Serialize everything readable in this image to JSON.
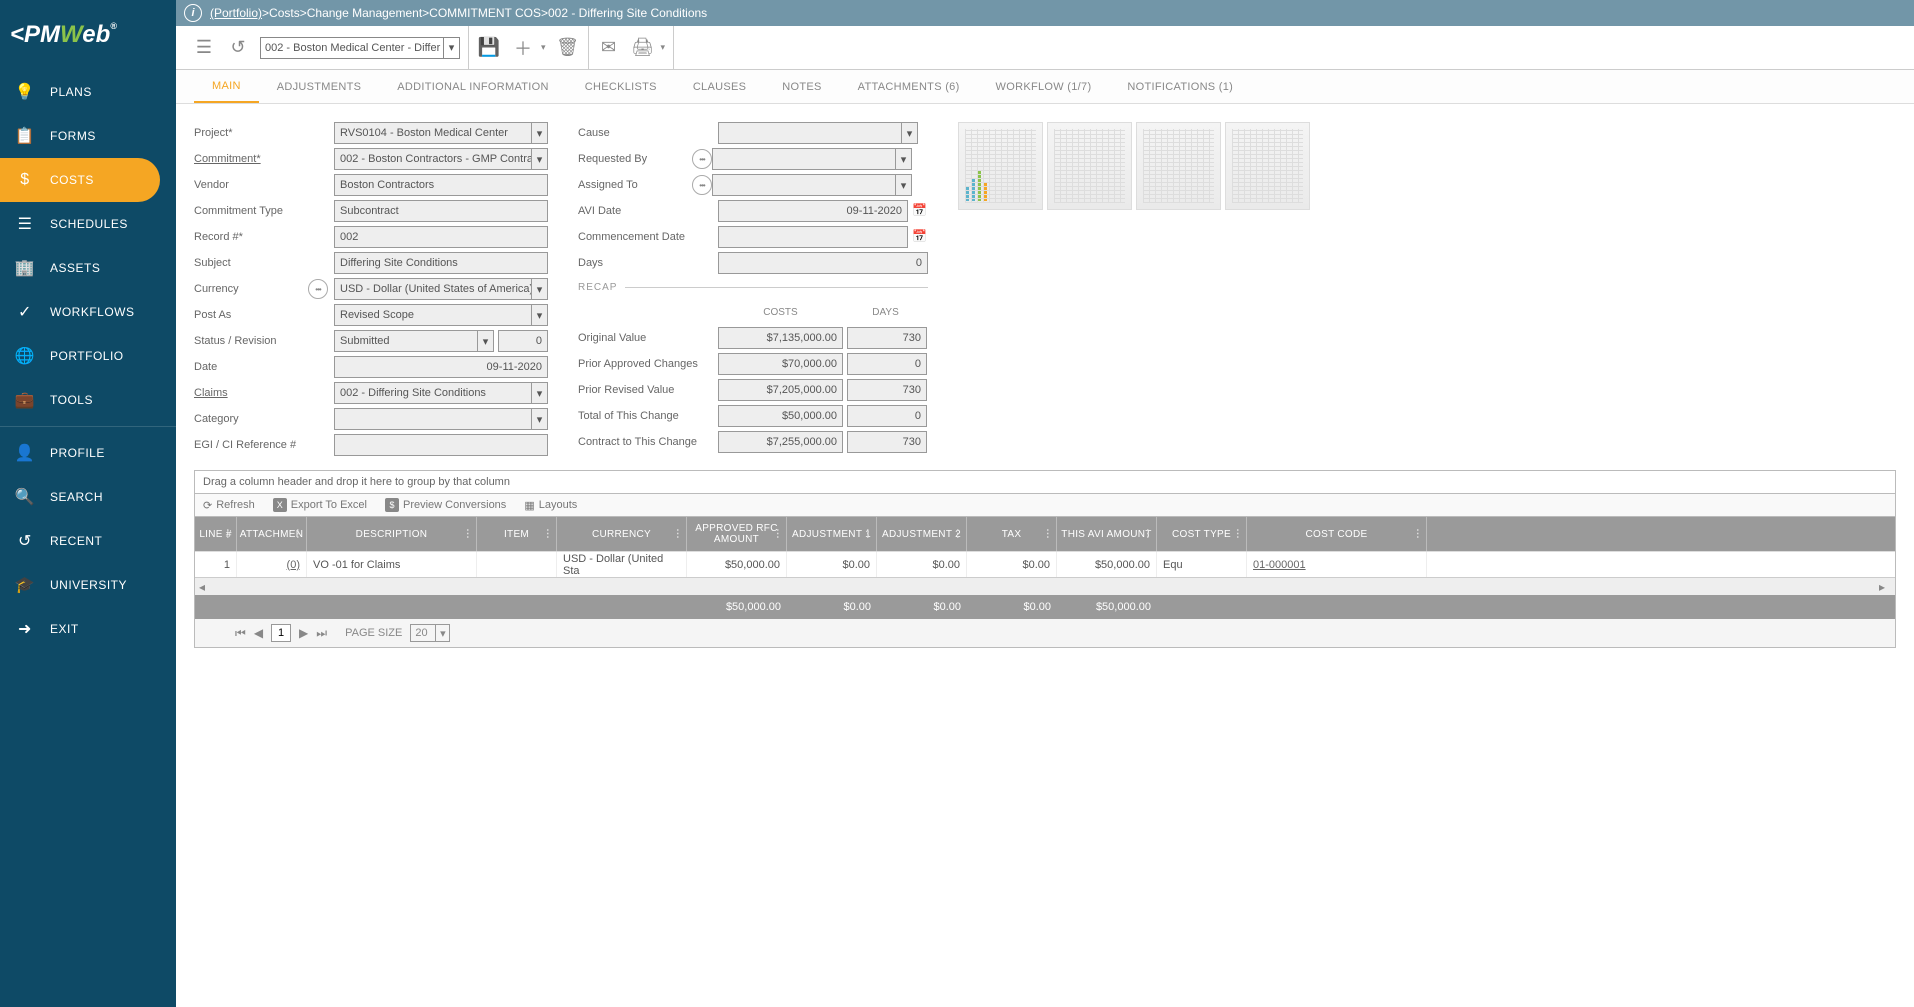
{
  "breadcrumb": {
    "root": "(Portfolio)",
    "sep": " > ",
    "items": [
      "Costs",
      "Change Management",
      "COMMITMENT COS",
      "002 - Differing Site Conditions"
    ]
  },
  "toolbar": {
    "record_selector": "002 - Boston Medical Center - Differ"
  },
  "sidebar": {
    "items": [
      "PLANS",
      "FORMS",
      "COSTS",
      "SCHEDULES",
      "ASSETS",
      "WORKFLOWS",
      "PORTFOLIO",
      "TOOLS"
    ],
    "footer": [
      "PROFILE",
      "SEARCH",
      "RECENT",
      "UNIVERSITY",
      "EXIT"
    ]
  },
  "tabs": [
    "MAIN",
    "ADJUSTMENTS",
    "ADDITIONAL INFORMATION",
    "CHECKLISTS",
    "CLAUSES",
    "NOTES",
    "ATTACHMENTS (6)",
    "WORKFLOW (1/7)",
    "NOTIFICATIONS (1)"
  ],
  "form": {
    "project_lbl": "Project*",
    "project": "RVS0104 - Boston Medical Center",
    "commitment_lbl": "Commitment*",
    "commitment": "002 - Boston Contractors - GMP Contra",
    "vendor_lbl": "Vendor",
    "vendor": "Boston Contractors",
    "ctype_lbl": "Commitment Type",
    "ctype": "Subcontract",
    "recnum_lbl": "Record #*",
    "recnum": "002",
    "subject_lbl": "Subject",
    "subject": "Differing Site Conditions",
    "currency_lbl": "Currency",
    "currency": "USD - Dollar (United States of America)",
    "postas_lbl": "Post As",
    "postas": "Revised Scope",
    "status_lbl": "Status / Revision",
    "status": "Submitted",
    "revision": "0",
    "date_lbl": "Date",
    "date": "09-11-2020",
    "claims_lbl": "Claims",
    "claims": "002 - Differing Site Conditions",
    "category_lbl": "Category",
    "category": "",
    "egi_lbl": "EGI / CI Reference #",
    "egi": "",
    "cause_lbl": "Cause",
    "cause": "",
    "reqby_lbl": "Requested By",
    "reqby": "",
    "assignto_lbl": "Assigned To",
    "assignto": "",
    "avidate_lbl": "AVI Date",
    "avidate": "09-11-2020",
    "commdate_lbl": "Commencement Date",
    "commdate": "",
    "days_lbl": "Days",
    "days": "0",
    "recap_lbl": "RECAP",
    "costs_hdr": "COSTS",
    "days_hdr": "DAYS",
    "orig_lbl": "Original Value",
    "orig_cost": "$7,135,000.00",
    "orig_days": "730",
    "prior_lbl": "Prior Approved Changes",
    "prior_cost": "$70,000.00",
    "prior_days": "0",
    "priorrev_lbl": "Prior Revised Value",
    "priorrev_cost": "$7,205,000.00",
    "priorrev_days": "730",
    "thischange_lbl": "Total of This Change",
    "thischange_cost": "$50,000.00",
    "thischange_days": "0",
    "contract_lbl": "Contract to This Change",
    "contract_cost": "$7,255,000.00",
    "contract_days": "730"
  },
  "grid": {
    "group_hint": "Drag a column header and drop it here to group by that column",
    "tb_refresh": "Refresh",
    "tb_export": "Export To Excel",
    "tb_preview": "Preview Conversions",
    "tb_layouts": "Layouts",
    "headers": {
      "line": "LINE #",
      "att": "ATTACHMEN",
      "desc": "DESCRIPTION",
      "item": "ITEM",
      "curr": "CURRENCY",
      "amt": "APPROVED RFC AMOUNT",
      "adj1": "ADJUSTMENT 1",
      "adj2": "ADJUSTMENT 2",
      "tax": "TAX",
      "avi": "THIS AVI AMOUNT",
      "type": "COST TYPE",
      "code": "COST CODE"
    },
    "row": {
      "line": "1",
      "att": "(0)",
      "desc": "VO -01 for Claims",
      "item": "",
      "curr": "USD - Dollar (United Sta",
      "amt": "$50,000.00",
      "adj1": "$0.00",
      "adj2": "$0.00",
      "tax": "$0.00",
      "avi": "$50,000.00",
      "type": "Equ",
      "code": "01-000001"
    },
    "totals": {
      "amt": "$50,000.00",
      "adj1": "$0.00",
      "adj2": "$0.00",
      "tax": "$0.00",
      "avi": "$50,000.00"
    },
    "pager": {
      "page": "1",
      "size_lbl": "PAGE SIZE",
      "size": "20"
    }
  }
}
